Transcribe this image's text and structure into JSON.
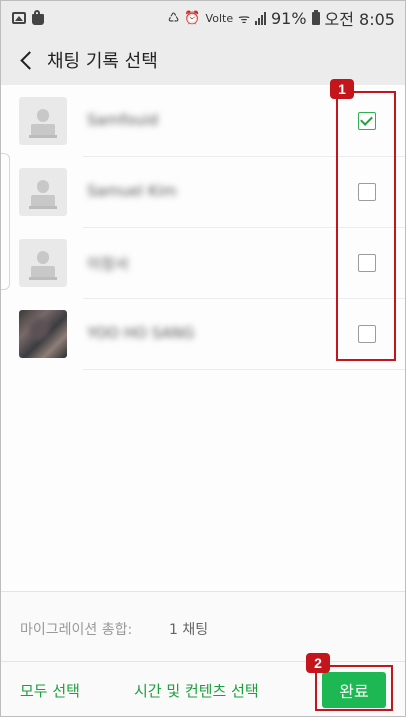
{
  "status_bar": {
    "volte": "Volte",
    "battery_pct": "91%",
    "time": "오전 8:05"
  },
  "header": {
    "title": "채팅 기록 선택",
    "back_icon": "chevron-left-icon"
  },
  "contacts": [
    {
      "name": "Samfouid",
      "checked": true,
      "avatar": "default"
    },
    {
      "name": "Samuel Kim",
      "checked": false,
      "avatar": "default"
    },
    {
      "name": "이정서",
      "checked": false,
      "avatar": "default"
    },
    {
      "name": "YOO HO SANG",
      "checked": false,
      "avatar": "photo"
    }
  ],
  "summary": {
    "label": "마이그레이션 총합:",
    "value": "1 채팅"
  },
  "bottom_bar": {
    "select_all": "모두 선택",
    "time_content": "시간 및 컨텐츠 선택",
    "done": "완료"
  },
  "annotations": {
    "one": "1",
    "two": "2",
    "color": "#c4151c"
  },
  "colors": {
    "accent": "#1db853",
    "link": "#1e9f3d"
  }
}
